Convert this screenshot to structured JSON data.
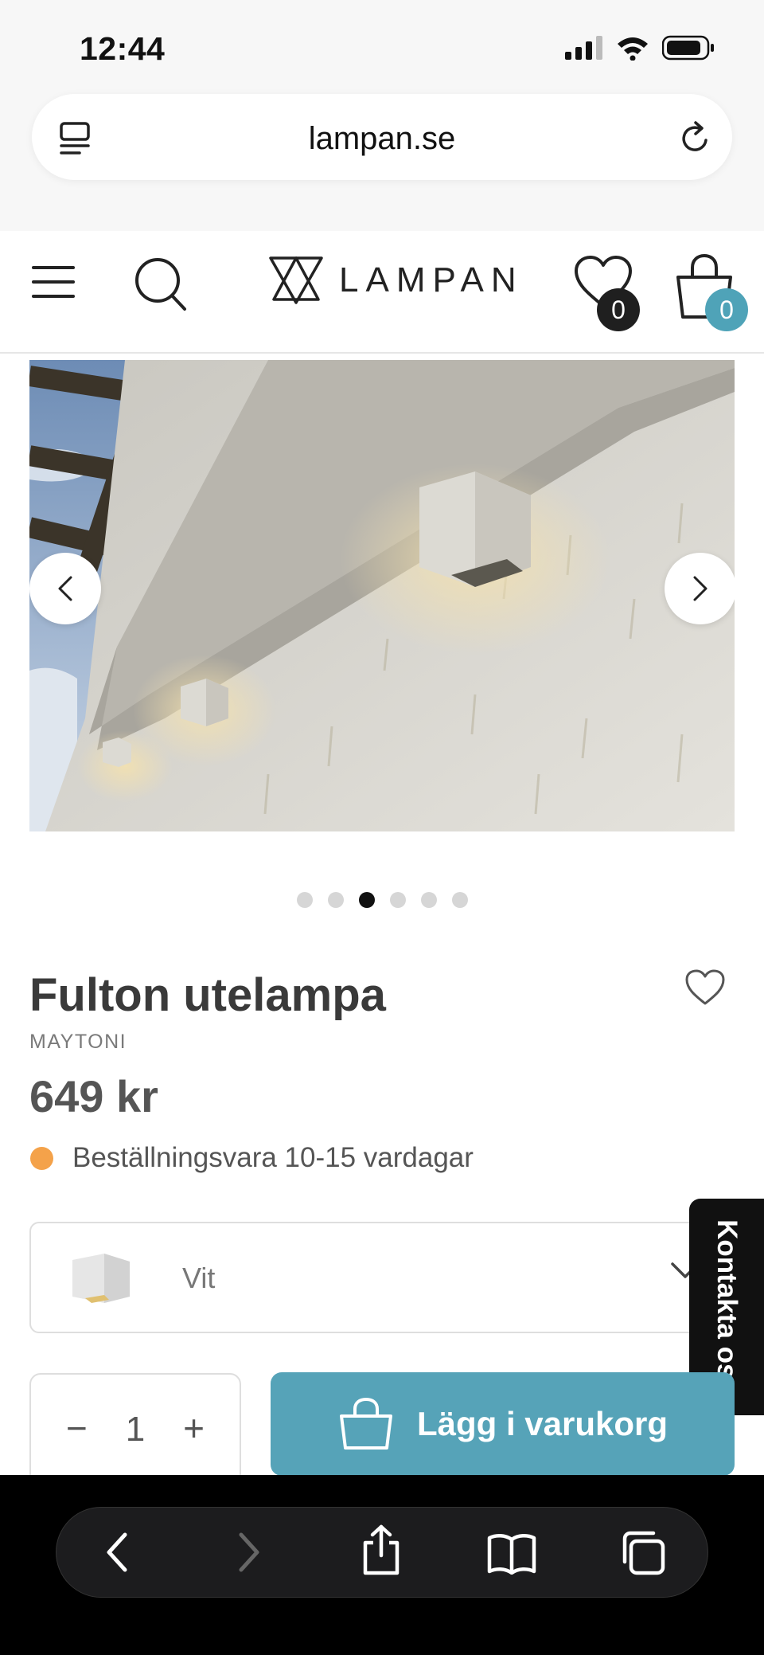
{
  "status_bar": {
    "time": "12:44"
  },
  "browser": {
    "url": "lampan.se"
  },
  "header": {
    "logo_text": "LAMPAN",
    "wishlist_count": "0",
    "cart_count": "0"
  },
  "carousel": {
    "slide_count": 6,
    "active_index": 2
  },
  "product": {
    "title": "Fulton utelampa",
    "brand": "MAYTONI",
    "price": "649 kr",
    "stock_status": "Beställningsvara 10-15 vardagar",
    "stock_color": "#f4a24a"
  },
  "variant": {
    "selected": "Vit"
  },
  "quantity": {
    "minus": "−",
    "value": "1",
    "plus": "+"
  },
  "add_to_cart": {
    "label": "Lägg i varukorg",
    "color": "#56a3b8"
  },
  "contact": {
    "label": "Kontakta oss"
  },
  "icons": {
    "url_menu": "tab-menu-icon",
    "reload": "reload-icon",
    "menu": "hamburger-icon",
    "search": "search-icon",
    "wishlist": "heart-icon",
    "cart": "shopping-bag-icon",
    "toolbar": [
      "back-icon",
      "forward-icon",
      "share-icon",
      "bookmarks-icon",
      "tabs-icon"
    ]
  }
}
